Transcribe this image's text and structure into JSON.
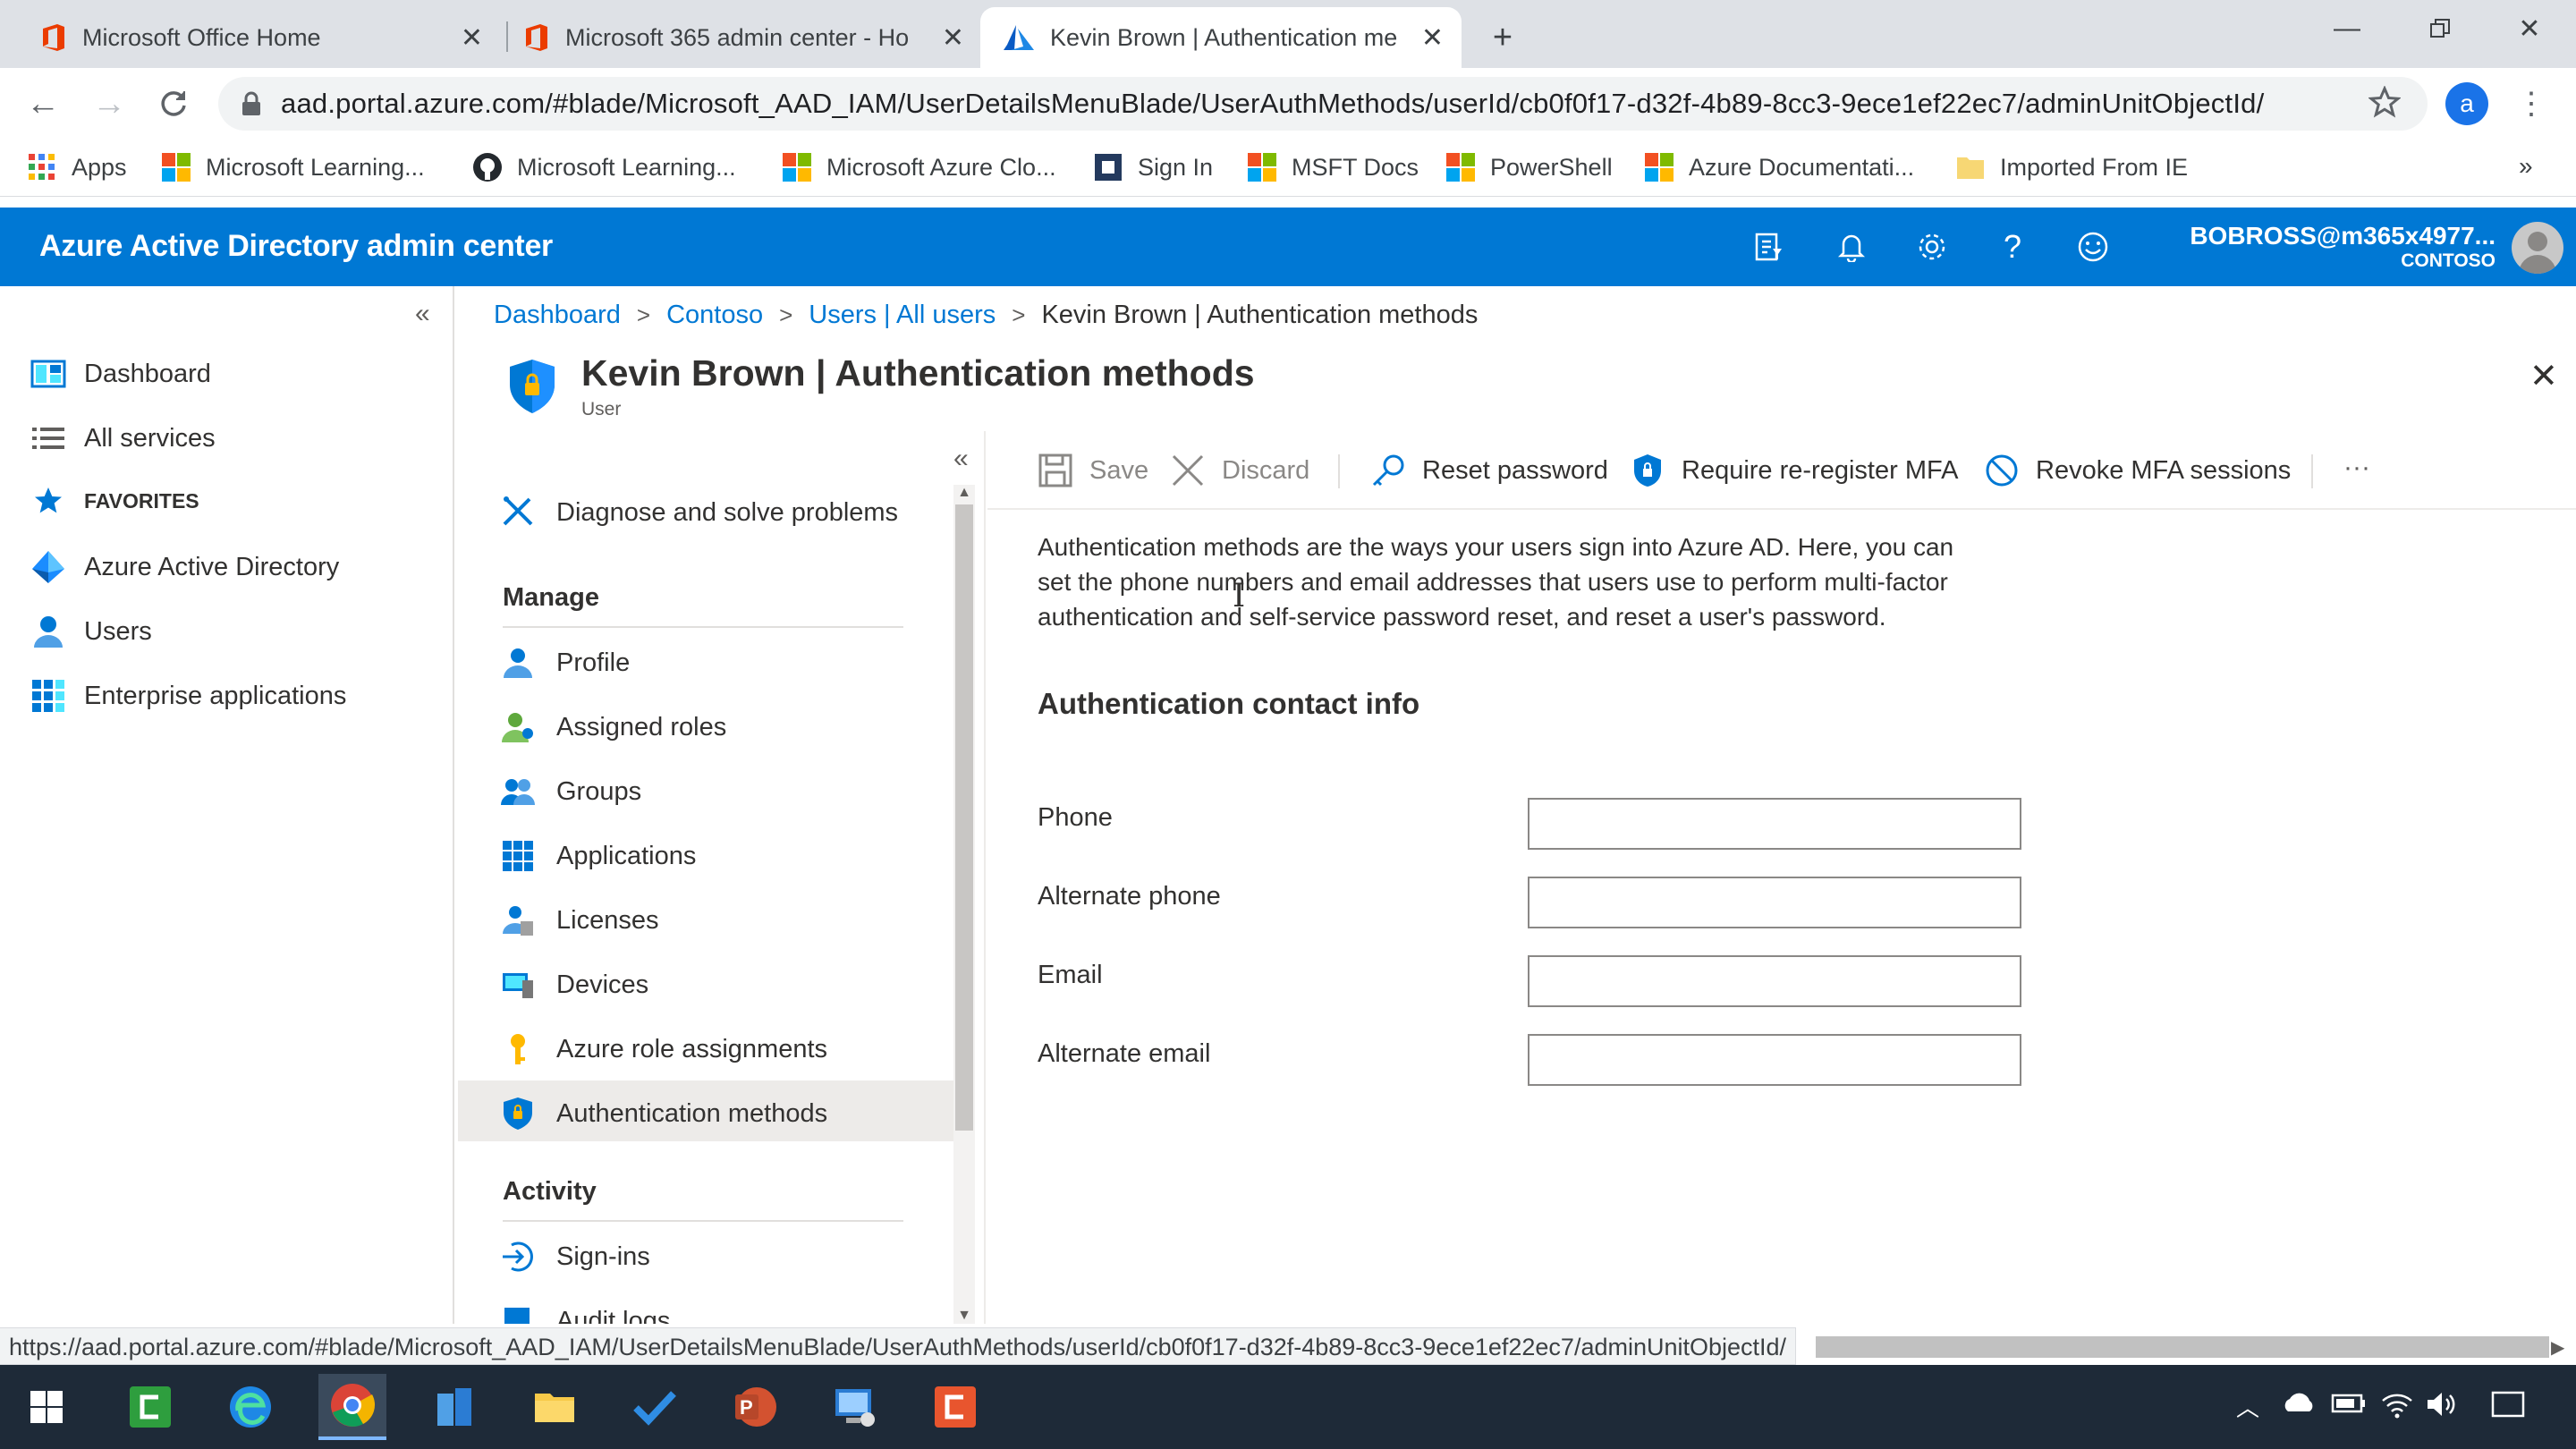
{
  "browser": {
    "tabs": [
      {
        "title": "Microsoft Office Home"
      },
      {
        "title": "Microsoft 365 admin center - Ho"
      },
      {
        "title": "Kevin Brown | Authentication me"
      }
    ],
    "url": "aad.portal.azure.com/#blade/Microsoft_AAD_IAM/UserDetailsMenuBlade/UserAuthMethods/userId/cb0f0f17-d32f-4b89-8cc3-9ece1ef22ec7/adminUnitObjectId/",
    "profile_initial": "a",
    "bookmarks": [
      {
        "label": "Apps"
      },
      {
        "label": "Microsoft Learning..."
      },
      {
        "label": "Microsoft Learning..."
      },
      {
        "label": "Microsoft Azure Clo..."
      },
      {
        "label": "Sign In"
      },
      {
        "label": "MSFT Docs"
      },
      {
        "label": "PowerShell"
      },
      {
        "label": "Azure Documentati..."
      },
      {
        "label": "Imported From IE"
      }
    ],
    "status_url": "https://aad.portal.azure.com/#blade/Microsoft_AAD_IAM/UserDetailsMenuBlade/UserAuthMethods/userId/cb0f0f17-d32f-4b89-8cc3-9ece1ef22ec7/adminUnitObjectId/"
  },
  "portal": {
    "title": "Azure Active Directory admin center",
    "account_user": "BOBROSS@m365x4977...",
    "account_tenant": "CONTOSO",
    "header_color": "#0078d4"
  },
  "leftnav": {
    "dashboard": "Dashboard",
    "all_services": "All services",
    "favorites": "FAVORITES",
    "favorites_items": [
      {
        "label": "Azure Active Directory"
      },
      {
        "label": "Users"
      },
      {
        "label": "Enterprise applications"
      }
    ]
  },
  "breadcrumb": {
    "items": [
      "Dashboard",
      "Contoso",
      "Users | All users"
    ],
    "current": "Kevin Brown | Authentication methods"
  },
  "blade": {
    "title": "Kevin Brown | Authentication methods",
    "subtitle": "User"
  },
  "menu": {
    "diagnose": "Diagnose and solve problems",
    "manage_header": "Manage",
    "manage_items": [
      {
        "label": "Profile",
        "icon": "profile-icon"
      },
      {
        "label": "Assigned roles",
        "icon": "roles-icon"
      },
      {
        "label": "Groups",
        "icon": "groups-icon"
      },
      {
        "label": "Applications",
        "icon": "applications-icon"
      },
      {
        "label": "Licenses",
        "icon": "licenses-icon"
      },
      {
        "label": "Devices",
        "icon": "devices-icon"
      },
      {
        "label": "Azure role assignments",
        "icon": "key-icon"
      },
      {
        "label": "Authentication methods",
        "icon": "shield-icon"
      }
    ],
    "activity_header": "Activity",
    "activity_items": [
      {
        "label": "Sign-ins"
      },
      {
        "label": "Audit logs"
      }
    ]
  },
  "commands": {
    "save": "Save",
    "discard": "Discard",
    "reset_password": "Reset password",
    "require_mfa": "Require re-register MFA",
    "revoke_mfa": "Revoke MFA sessions",
    "more": "···"
  },
  "content": {
    "description_lines": [
      "Authentication methods are the ways your users sign into Azure AD. Here, you can",
      "set the phone numbers and email addresses that users use to perform multi-factor",
      "authentication and self-service password reset, and reset a user's password."
    ],
    "section_header": "Authentication contact info",
    "fields": [
      {
        "label": "Phone",
        "value": ""
      },
      {
        "label": "Alternate phone",
        "value": ""
      },
      {
        "label": "Email",
        "value": ""
      },
      {
        "label": "Alternate email",
        "value": ""
      }
    ]
  }
}
